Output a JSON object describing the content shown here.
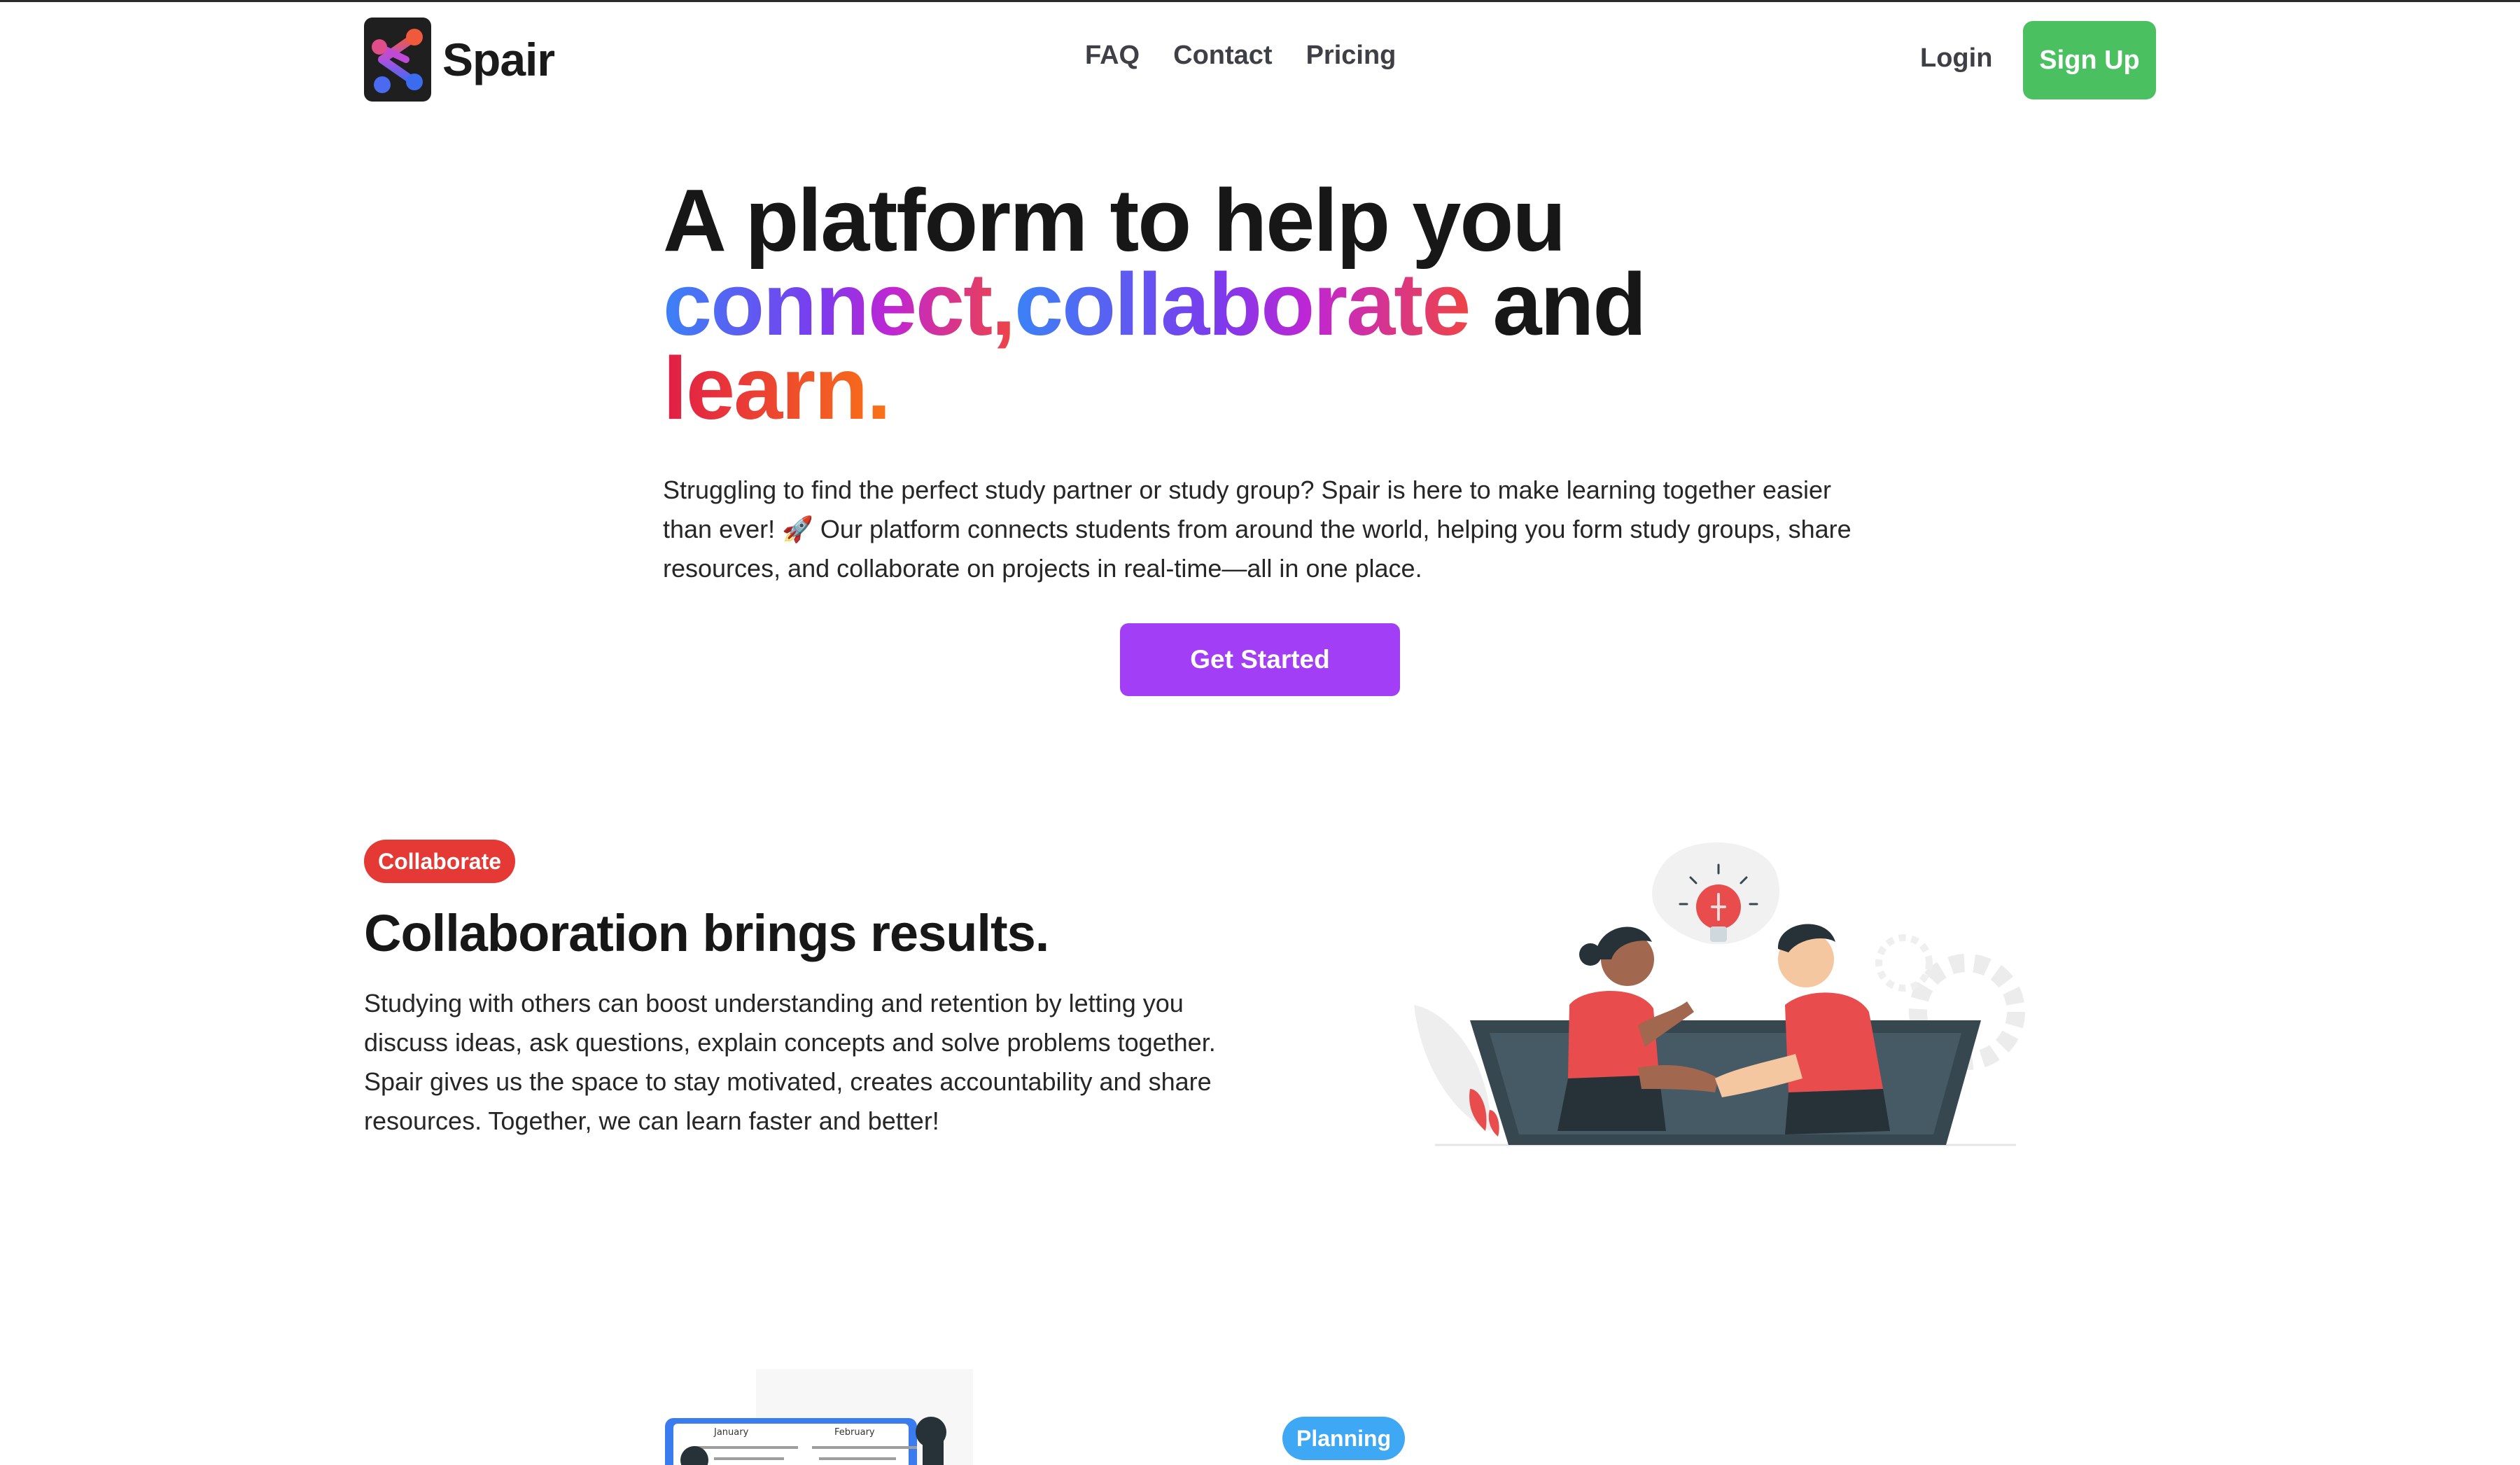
{
  "brand": {
    "name": "Spair"
  },
  "nav": {
    "links": [
      "FAQ",
      "Contact",
      "Pricing"
    ],
    "login": "Login",
    "signup": "Sign Up"
  },
  "hero": {
    "title_line1": "A platform to help you",
    "title_connect": "connect,",
    "title_collaborate": "collaborate",
    "title_and": " and",
    "title_learn": "learn.",
    "description": "Struggling to find the perfect study partner or study group? Spair is here to make learning together easier than ever! 🚀 Our platform connects students from around the world, helping you form study groups, share resources, and collaborate on projects in real-time—all in one place.",
    "cta": "Get Started"
  },
  "collaborate": {
    "badge": "Collaborate",
    "title": "Collaboration brings results.",
    "description": "Studying with others can boost understanding and retention by letting you discuss ideas, ask questions, explain concepts and solve problems together. Spair gives us the space to stay motivated, creates accountability and share resources. Together, we can learn faster and better!"
  },
  "planning": {
    "badge": "Planning",
    "calendar_months": [
      "January",
      "February"
    ]
  },
  "colors": {
    "signup": "#4ac061",
    "cta": "#a23ef5",
    "badge_collaborate": "#e53935",
    "badge_planning": "#3ea8f5",
    "illustration_accent": "#e84c4c"
  }
}
